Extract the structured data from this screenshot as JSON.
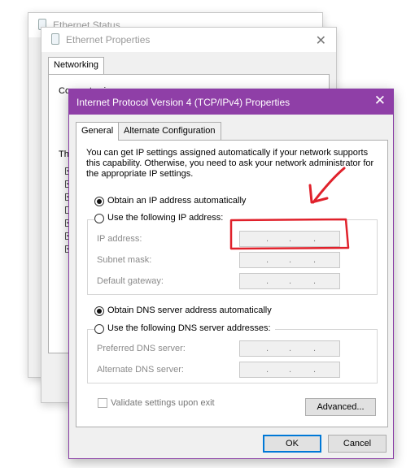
{
  "status_window": {
    "title": "Ethernet Status"
  },
  "properties_window": {
    "title": "Ethernet Properties",
    "tab": "Networking",
    "fragments": {
      "connect": "Connect using:",
      "uses": "Th"
    }
  },
  "ipv4_dialog": {
    "title": "Internet Protocol Version 4 (TCP/IPv4) Properties",
    "tabs": [
      "General",
      "Alternate Configuration"
    ],
    "description": "You can get IP settings assigned automatically if your network supports this capability. Otherwise, you need to ask your network administrator for the appropriate IP settings.",
    "ip_mode": {
      "auto_label": "Obtain an IP address automatically",
      "manual_label": "Use the following IP address:",
      "selected": "auto"
    },
    "ip_fields": [
      {
        "label": "IP address:",
        "value": ". . ."
      },
      {
        "label": "Subnet mask:",
        "value": ". . ."
      },
      {
        "label": "Default gateway:",
        "value": ". . ."
      }
    ],
    "dns_mode": {
      "auto_label": "Obtain DNS server address automatically",
      "manual_label": "Use the following DNS server addresses:",
      "selected": "auto"
    },
    "dns_fields": [
      {
        "label": "Preferred DNS server:",
        "value": ". . ."
      },
      {
        "label": "Alternate DNS server:",
        "value": ". . ."
      }
    ],
    "validate_label": "Validate settings upon exit",
    "advanced_label": "Advanced...",
    "ok_label": "OK",
    "cancel_label": "Cancel",
    "close_glyph": "✕"
  },
  "colors": {
    "title_bar": "#8f3fa7",
    "annotation": "#e0212b",
    "focus": "#0078d7"
  }
}
